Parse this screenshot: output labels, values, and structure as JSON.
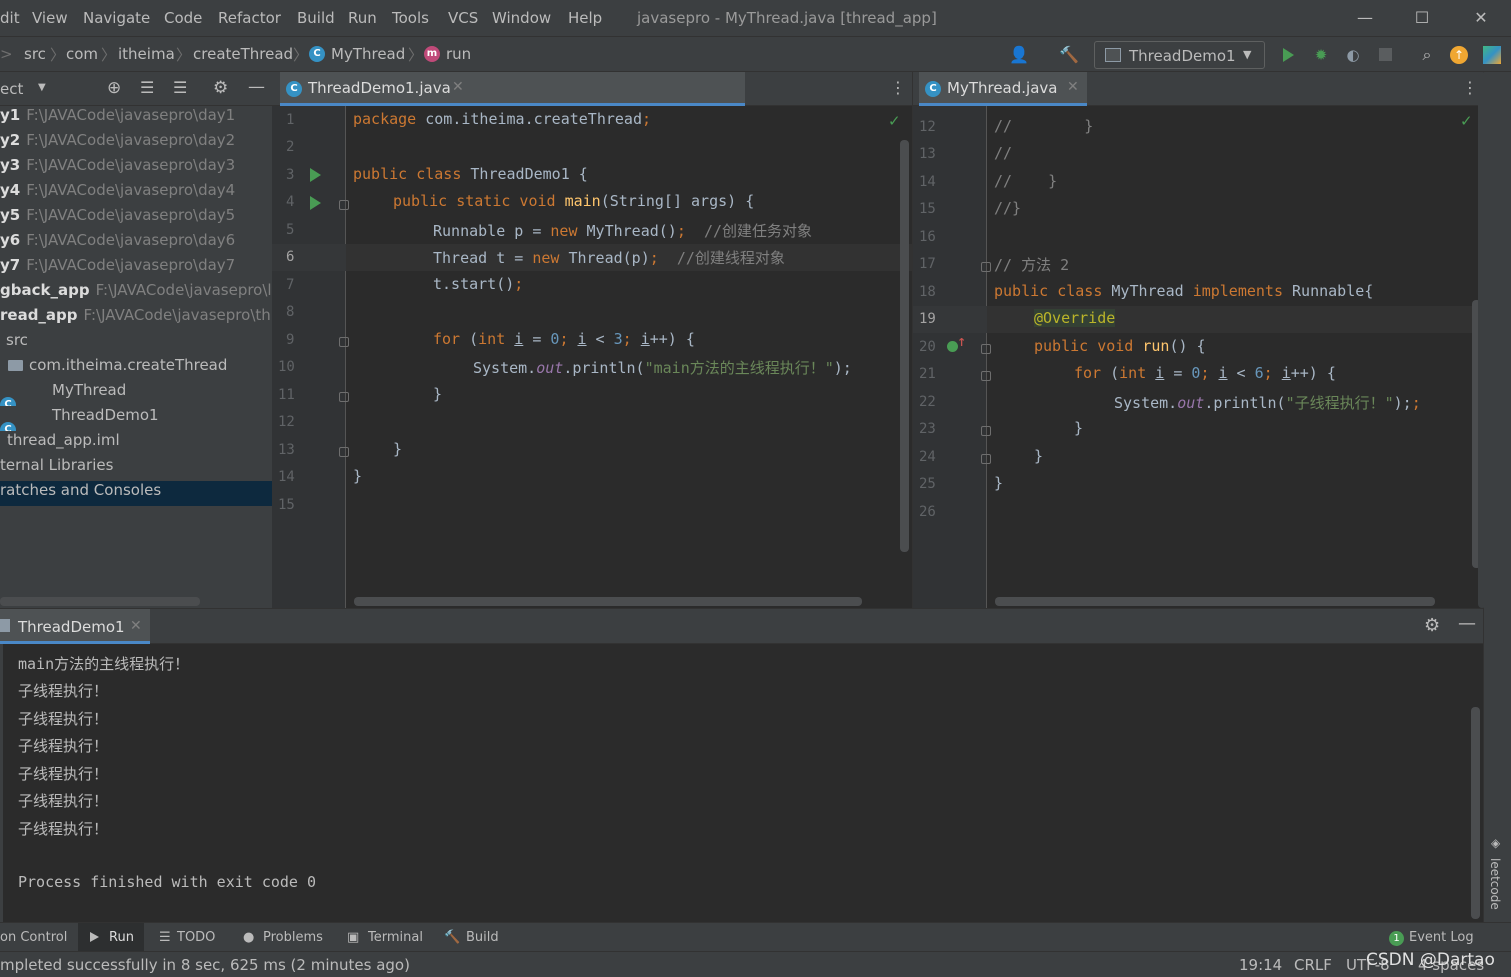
{
  "menu": {
    "items": [
      "dit",
      "View",
      "Navigate",
      "Code",
      "Refactor",
      "Build",
      "Run",
      "Tools",
      "VCS",
      "Window",
      "Help"
    ],
    "window_title": "javasepro - MyThread.java [thread_app]"
  },
  "window_controls": {
    "minimize": "—",
    "maximize": "☐",
    "close": "✕"
  },
  "breadcrumb": {
    "items": [
      ">",
      "src",
      "com",
      "itheima",
      "createThread",
      "MyThread",
      "run"
    ],
    "class_icon": "C",
    "method_icon": "m"
  },
  "run_config": {
    "label": "ThreadDemo1"
  },
  "project": {
    "header_label": "ect",
    "tree": [
      {
        "name": "y1",
        "path": "F:\\JAVACode\\javasepro\\day1",
        "bold": true
      },
      {
        "name": "y2",
        "path": "F:\\JAVACode\\javasepro\\day2",
        "bold": true
      },
      {
        "name": "y3",
        "path": "F:\\JAVACode\\javasepro\\day3",
        "bold": true
      },
      {
        "name": "y4",
        "path": "F:\\JAVACode\\javasepro\\day4",
        "bold": true
      },
      {
        "name": "y5",
        "path": "F:\\JAVACode\\javasepro\\day5",
        "bold": true
      },
      {
        "name": "y6",
        "path": "F:\\JAVACode\\javasepro\\day6",
        "bold": true
      },
      {
        "name": "y7",
        "path": "F:\\JAVACode\\javasepro\\day7",
        "bold": true
      },
      {
        "name": "gback_app",
        "path": "F:\\JAVACode\\javasepro\\lc",
        "bold": true
      },
      {
        "name": "read_app",
        "path": "F:\\JAVACode\\javasepro\\thr",
        "bold": true
      }
    ],
    "src": "src",
    "package": "com.itheima.createThread",
    "class1": "MyThread",
    "class2": "ThreadDemo1",
    "iml": "thread_app.iml",
    "ext_libs": "ternal Libraries",
    "scratches": "ratches and Consoles"
  },
  "left_editor": {
    "tab_label": "ThreadDemo1.java",
    "line_numbers": [
      "1",
      "2",
      "3",
      "4",
      "5",
      "6",
      "7",
      "8",
      "9",
      "10",
      "11",
      "12",
      "13",
      "14",
      "15"
    ],
    "code": {
      "l1_kw": "package ",
      "l1_rest": "com.itheima.createThread",
      "l3_kw": "public class ",
      "l3_rest": "ThreadDemo1 {",
      "l4_kw": "public static void ",
      "l4_fn": "main",
      "l4_rest": "(String[] args) {",
      "l5_a": "Runnable p = ",
      "l5_kw": "new ",
      "l5_b": "MyThread()",
      "l5_c": "//创建任务对象",
      "l6_a": "Thread t = ",
      "l6_kw": "new ",
      "l6_b": "Thread(p)",
      "l6_c": "//创建线程对象",
      "l7": "t.start()",
      "l9_kw": "for ",
      "l9_a": "(",
      "l9_int": "int ",
      "l9_i": "i",
      "l9_eq": " = ",
      "l9_0": "0",
      "l9_i2": "i",
      "l9_lt": " < ",
      "l9_3": "3",
      "l9_i3": "i",
      "l9_end": "++) {",
      "l10_a": "System.",
      "l10_out": "out",
      "l10_b": ".println(",
      "l10_str": "\"main方法的主线程执行！\"",
      "l10_c": ");",
      "l11": "}",
      "l13": "}",
      "l14": "}"
    }
  },
  "right_editor": {
    "tab_label": "MyThread.java",
    "line_numbers": [
      "12",
      "13",
      "14",
      "15",
      "16",
      "17",
      "18",
      "19",
      "20",
      "21",
      "22",
      "23",
      "24",
      "25",
      "26"
    ],
    "code": {
      "l12": "//        }",
      "l13": "//",
      "l14": "//    }",
      "l15": "//}",
      "l17": "// 方法 2",
      "l18_kw": "public class ",
      "l18_a": "MyThread ",
      "l18_kw2": "implements ",
      "l18_b": "Runnable{",
      "l19": "@Override",
      "l20_kw": "public void ",
      "l20_fn": "run",
      "l20_rest": "() {",
      "l21_kw": "for ",
      "l21_int": "int ",
      "l21_i": "i",
      "l21_eq": " = ",
      "l21_0": "0",
      "l21_i2": "i",
      "l21_lt": " < ",
      "l21_6": "6",
      "l21_i3": "i",
      "l21_end": "++) {",
      "l22_a": "System.",
      "l22_out": "out",
      "l22_b": ".println(",
      "l22_str": "\"子线程执行！\"",
      "l22_c": ");",
      "l23": "}",
      "l24": "}",
      "l25": "}"
    }
  },
  "run_panel": {
    "tab_label": "ThreadDemo1",
    "output": [
      "main方法的主线程执行！",
      "子线程执行！",
      "子线程执行！",
      "子线程执行！",
      "子线程执行！",
      "子线程执行！",
      "子线程执行！",
      "",
      "Process finished with exit code 0"
    ]
  },
  "right_stripe": {
    "label": "leetcode"
  },
  "bottom_tools": {
    "items": [
      "on Control",
      "Run",
      "TODO",
      "Problems",
      "Terminal",
      "Build"
    ],
    "event_log": "Event Log",
    "event_count": "1"
  },
  "status": {
    "message": "mpleted successfully in 8 sec, 625 ms (2 minutes ago)",
    "position": "19:14",
    "line_sep": "CRLF",
    "encoding": "UTF-8",
    "indent": "4 spaces",
    "watermark": "CSDN @Dartao"
  },
  "colors": {
    "accent": "#4a88c7",
    "run_green": "#499c54",
    "keyword": "#cc7832",
    "string": "#6a8759"
  }
}
